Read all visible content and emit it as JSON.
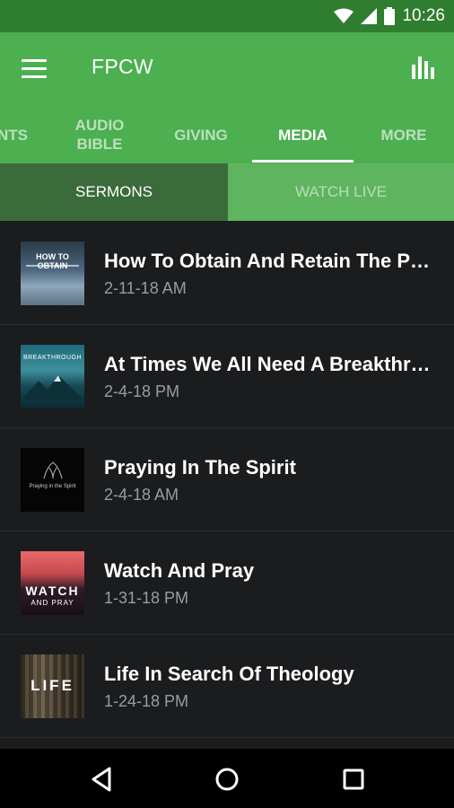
{
  "status": {
    "time": "10:26"
  },
  "appbar": {
    "title": "FPCW"
  },
  "tabs": [
    {
      "label": "NTS"
    },
    {
      "label": "AUDIO BIBLE"
    },
    {
      "label": "GIVING"
    },
    {
      "label": "MEDIA"
    },
    {
      "label": "MORE"
    }
  ],
  "subtabs": {
    "sermons": "SERMONS",
    "watch_live": "WATCH LIVE"
  },
  "sermons": [
    {
      "title": "How To Obtain And Retain The Presence Of God",
      "date": "2-11-18 AM",
      "thumb_text": "HOW TO OBTAIN"
    },
    {
      "title": "At Times We All Need A Breakthrough",
      "date": "2-4-18 PM",
      "thumb_text": "BREAKTHROUGH"
    },
    {
      "title": "Praying In The Spirit",
      "date": "2-4-18 AM",
      "thumb_text": "Praying in the Spirit"
    },
    {
      "title": "Watch And Pray",
      "date": "1-31-18 PM",
      "thumb_text": "WATCH",
      "thumb_sub": "AND PRAY"
    },
    {
      "title": "Life In Search Of Theology",
      "date": "1-24-18 PM",
      "thumb_text": "LIFE"
    }
  ],
  "colors": {
    "primary": "#4caf50",
    "status": "#2f7d2f",
    "background": "#1b1c1e"
  },
  "icons": [
    "wifi-icon",
    "signal-icon",
    "battery-icon",
    "menu-icon",
    "chart-icon",
    "back-icon",
    "home-icon",
    "recents-icon"
  ]
}
